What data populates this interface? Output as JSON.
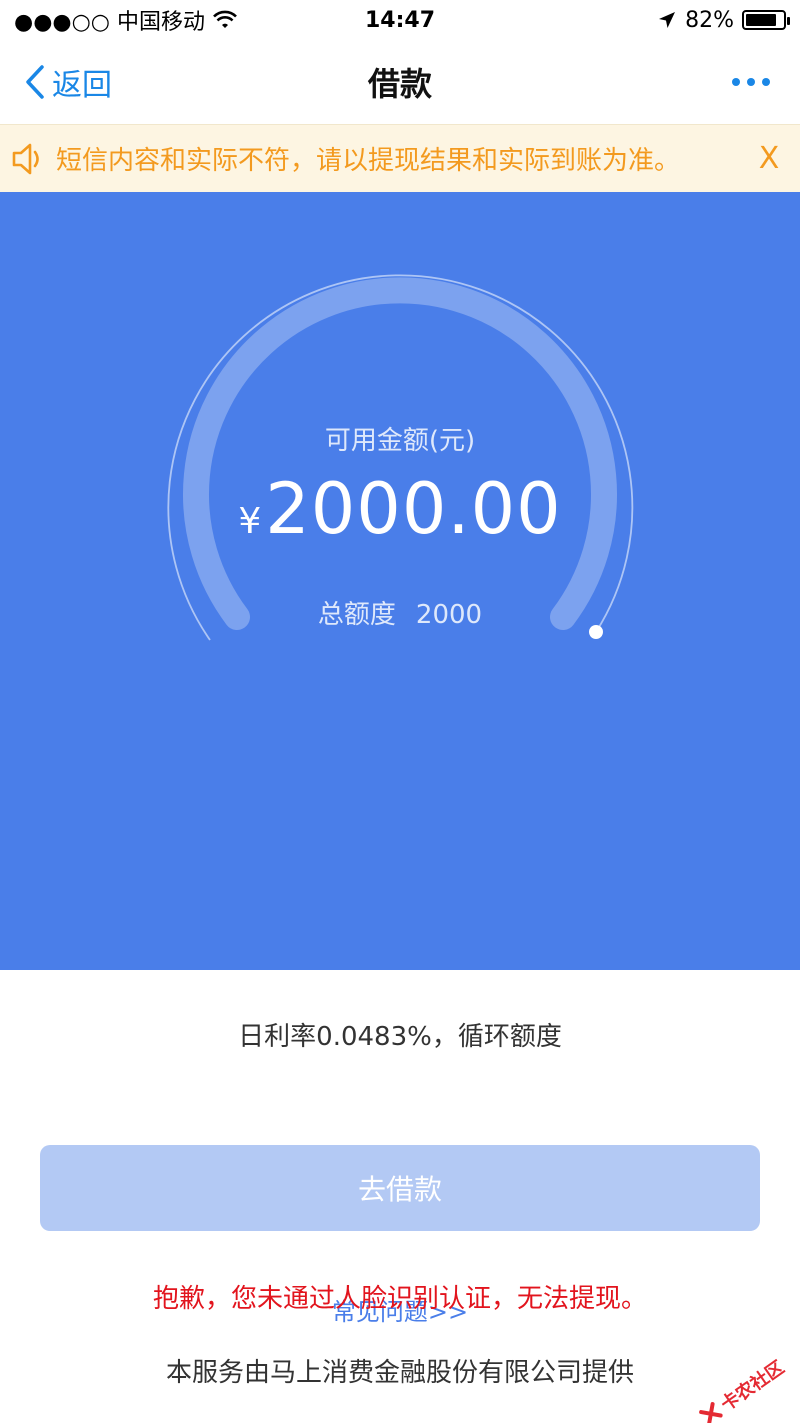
{
  "status_bar": {
    "carrier": "●●●○○ 中国移动",
    "time": "14:47",
    "battery": "82%",
    "battery_level": 0.82
  },
  "nav": {
    "back_label": "返回",
    "title": "借款"
  },
  "notice": {
    "text": "短信内容和实际不符，请以提现结果和实际到账为准。",
    "close_label": "X"
  },
  "gauge": {
    "label": "可用金额(元)",
    "currency": "¥",
    "amount": "2000.00",
    "total_label": "总额度",
    "total_value": "2000"
  },
  "rate_text": "日利率0.0483%，循环额度",
  "button": {
    "label": "去借款"
  },
  "faq_link": "常见问题>>",
  "error_message": "抱歉，您未通过人脸识别认证，无法提现。",
  "footer": "本服务由马上消费金融股份有限公司提供",
  "watermark": "卡农社区",
  "colors": {
    "hero_blue": "#4a7ee9",
    "link_blue": "#1a87e6",
    "notice_orange": "#f39a1f",
    "error_red": "#e2141d",
    "button_disabled": "#b3c9f4"
  }
}
